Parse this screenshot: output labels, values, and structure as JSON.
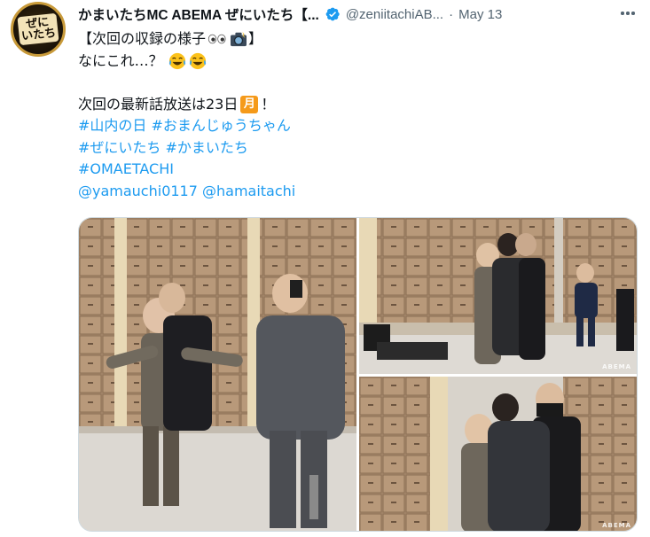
{
  "tweet": {
    "author_name": "かまいたちMC ABEMA ぜにいたち【...",
    "handle": "@zeniitachiAB...",
    "separator": "·",
    "date": "May 13",
    "avatar_text": "ぜに\nいたち",
    "lines": {
      "l1_text": "【次回の収録の様子",
      "l1_end": "】",
      "l2_text": "なにこれ…？",
      "l3_text": "次回の最新話放送は23日",
      "l3_moon": "月",
      "l3_end": "！",
      "tag1": "#山内の日",
      "tag2": "#おまんじゅうちゃん",
      "tag3": "#ぜにいたち",
      "tag4": "#かまいたち",
      "tag5": "#OMAETACHI",
      "mention1": "@yamauchi0117",
      "mention2": "@hamaitachi"
    },
    "watermark": "ABEMA"
  },
  "colors": {
    "link": "#1d9bf0",
    "text": "#0f1419",
    "secondary": "#536471",
    "verified": "#1d9bf0",
    "moon_badge": "#f59a1a"
  },
  "icons": [
    "verified-badge-icon",
    "more-options-icon",
    "eyes-emoji",
    "camera-flash-emoji",
    "tears-of-joy-emoji"
  ]
}
